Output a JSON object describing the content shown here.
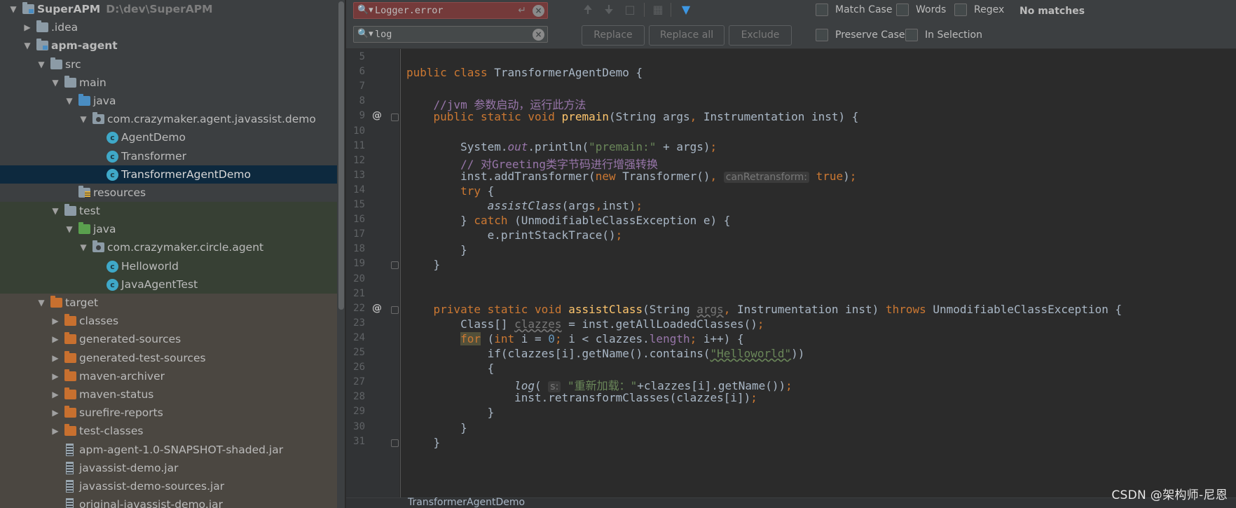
{
  "project_tree": {
    "rows": [
      {
        "label": "SuperAPM",
        "hint": "D:\\dev\\SuperAPM",
        "icon": "module-folder-icon",
        "expanded": true,
        "bold": true
      },
      {
        "label": ".idea",
        "icon": "folder-icon",
        "expanded": false
      },
      {
        "label": "apm-agent",
        "icon": "module-folder-icon",
        "expanded": true,
        "bold": true
      },
      {
        "label": "src",
        "icon": "folder-icon",
        "expanded": true
      },
      {
        "label": "main",
        "icon": "folder-icon",
        "expanded": true
      },
      {
        "label": "java",
        "icon": "source-root-icon",
        "expanded": true
      },
      {
        "label": "com.crazymaker.agent.javassist.demo",
        "icon": "package-icon",
        "expanded": true
      },
      {
        "label": "AgentDemo",
        "icon": "class-icon"
      },
      {
        "label": "Transformer",
        "icon": "class-icon"
      },
      {
        "label": "TransformerAgentDemo",
        "icon": "class-icon",
        "selected": true
      },
      {
        "label": "resources",
        "icon": "resources-folder-icon"
      },
      {
        "label": "test",
        "icon": "folder-icon",
        "expanded": true
      },
      {
        "label": "java",
        "icon": "test-source-root-icon",
        "expanded": true
      },
      {
        "label": "com.crazymaker.circle.agent",
        "icon": "package-icon",
        "expanded": true
      },
      {
        "label": "Helloworld",
        "icon": "class-icon"
      },
      {
        "label": "JavaAgentTest",
        "icon": "test-class-icon"
      },
      {
        "label": "target",
        "icon": "excluded-folder-icon",
        "expanded": true
      },
      {
        "label": "classes",
        "icon": "excluded-folder-icon",
        "expanded": false
      },
      {
        "label": "generated-sources",
        "icon": "excluded-folder-icon",
        "expanded": false
      },
      {
        "label": "generated-test-sources",
        "icon": "excluded-folder-icon",
        "expanded": false
      },
      {
        "label": "maven-archiver",
        "icon": "excluded-folder-icon",
        "expanded": false
      },
      {
        "label": "maven-status",
        "icon": "excluded-folder-icon",
        "expanded": false
      },
      {
        "label": "surefire-reports",
        "icon": "excluded-folder-icon",
        "expanded": false
      },
      {
        "label": "test-classes",
        "icon": "excluded-folder-icon",
        "expanded": false
      },
      {
        "label": "apm-agent-1.0-SNAPSHOT-shaded.jar",
        "icon": "jar-icon"
      },
      {
        "label": "javassist-demo.jar",
        "icon": "jar-icon"
      },
      {
        "label": "javassist-demo-sources.jar",
        "icon": "jar-icon"
      },
      {
        "label": "original-javassist-demo.jar",
        "icon": "jar-icon"
      }
    ]
  },
  "find_bar": {
    "search_value": "Logger.error",
    "replace_value": "log",
    "buttons": {
      "replace": "Replace",
      "replace_all": "Replace all",
      "exclude": "Exclude"
    },
    "options": {
      "match_case": "Match Case",
      "words": "Words",
      "regex": "Regex",
      "preserve_case": "Preserve Case",
      "in_selection": "In Selection"
    },
    "status": "No matches"
  },
  "editor": {
    "lines": [
      {
        "n": "5",
        "tokens": []
      },
      {
        "n": "6",
        "tokens": [
          {
            "t": "public class ",
            "c": "kw"
          },
          {
            "t": "TransformerAgentDemo {"
          }
        ]
      },
      {
        "n": "7",
        "tokens": []
      },
      {
        "n": "8",
        "tokens": [
          {
            "t": "    //jvm 参数启动，运行此方法",
            "c": "cm"
          }
        ]
      },
      {
        "n": "9",
        "mark": "@",
        "fold": true,
        "tokens": [
          {
            "t": "    public static void ",
            "c": "kw"
          },
          {
            "t": "premain",
            "c": "fn"
          },
          {
            "t": "(String args"
          },
          {
            "t": ", ",
            "c": "pn"
          },
          {
            "t": "Instrumentation inst) {"
          }
        ]
      },
      {
        "n": "10",
        "tokens": []
      },
      {
        "n": "11",
        "tokens": [
          {
            "t": "        System."
          },
          {
            "t": "out",
            "c": "field-it"
          },
          {
            "t": ".println("
          },
          {
            "t": "\"premain:\"",
            "c": "str"
          },
          {
            "t": " + args)"
          },
          {
            "t": ";",
            "c": "pn"
          }
        ]
      },
      {
        "n": "12",
        "tokens": [
          {
            "t": "        // 对Greeting类字节码进行增强转换",
            "c": "cm"
          }
        ]
      },
      {
        "n": "13",
        "tokens": [
          {
            "t": "        inst.addTransformer("
          },
          {
            "t": "new ",
            "c": "kw"
          },
          {
            "t": "Transformer()"
          },
          {
            "t": ", ",
            "c": "pn"
          },
          {
            "t": "canRetransform:",
            "c": "hint"
          },
          {
            "t": " "
          },
          {
            "t": "true",
            "c": "kw"
          },
          {
            "t": ")"
          },
          {
            "t": ";",
            "c": "pn"
          }
        ]
      },
      {
        "n": "14",
        "tokens": [
          {
            "t": "        "
          },
          {
            "t": "try ",
            "c": "kw"
          },
          {
            "t": "{"
          }
        ]
      },
      {
        "n": "15",
        "tokens": [
          {
            "t": "            "
          },
          {
            "t": "assistClass",
            "c": "it"
          },
          {
            "t": "(args"
          },
          {
            "t": ",",
            "c": "pn"
          },
          {
            "t": "inst)"
          },
          {
            "t": ";",
            "c": "pn"
          }
        ]
      },
      {
        "n": "16",
        "tokens": [
          {
            "t": "        } "
          },
          {
            "t": "catch ",
            "c": "kw"
          },
          {
            "t": "(UnmodifiableClassException e) {"
          }
        ]
      },
      {
        "n": "17",
        "tokens": [
          {
            "t": "            e.printStackTrace()"
          },
          {
            "t": ";",
            "c": "pn"
          }
        ]
      },
      {
        "n": "18",
        "tokens": [
          {
            "t": "        }"
          }
        ]
      },
      {
        "n": "19",
        "fold": true,
        "tokens": [
          {
            "t": "    }"
          }
        ]
      },
      {
        "n": "20",
        "tokens": []
      },
      {
        "n": "21",
        "tokens": []
      },
      {
        "n": "22",
        "mark": "@",
        "fold": true,
        "tokens": [
          {
            "t": "    private static void ",
            "c": "kw"
          },
          {
            "t": "assistClass",
            "c": "fn"
          },
          {
            "t": "(String "
          },
          {
            "t": "args",
            "c": "weak"
          },
          {
            "t": ", ",
            "c": "pn"
          },
          {
            "t": "Instrumentation inst) "
          },
          {
            "t": "throws ",
            "c": "kw"
          },
          {
            "t": "UnmodifiableClassException {"
          }
        ]
      },
      {
        "n": "23",
        "tokens": [
          {
            "t": "        Class[] "
          },
          {
            "t": "clazzes",
            "c": "wavy-plain"
          },
          {
            "t": " = inst.getAllLoadedClasses()"
          },
          {
            "t": ";",
            "c": "pn"
          }
        ]
      },
      {
        "n": "24",
        "tokens": [
          {
            "t": "        "
          },
          {
            "t": "for",
            "c": "kw-hl"
          },
          {
            "t": " ("
          },
          {
            "t": "int ",
            "c": "kw"
          },
          {
            "t": "i = "
          },
          {
            "t": "0",
            "c": "num"
          },
          {
            "t": "; ",
            "c": "pn"
          },
          {
            "t": "i < clazzes."
          },
          {
            "t": "length",
            "c": "field"
          },
          {
            "t": "; ",
            "c": "pn"
          },
          {
            "t": "i++) {"
          }
        ]
      },
      {
        "n": "25",
        "tokens": [
          {
            "t": "            if(clazzes[i].getName().contains("
          },
          {
            "t": "\"Helloworld\"",
            "c": "str-wavy"
          },
          {
            "t": "))"
          }
        ]
      },
      {
        "n": "26",
        "tokens": [
          {
            "t": "            {"
          }
        ]
      },
      {
        "n": "27",
        "tokens": [
          {
            "t": "                "
          },
          {
            "t": "log",
            "c": "it"
          },
          {
            "t": "( "
          },
          {
            "t": "s:",
            "c": "hint"
          },
          {
            "t": " "
          },
          {
            "t": "\"重新加载：\"",
            "c": "str"
          },
          {
            "t": "+clazzes[i].getName())"
          },
          {
            "t": ";",
            "c": "pn"
          }
        ]
      },
      {
        "n": "28",
        "tokens": [
          {
            "t": "                inst.retransformClasses(clazzes[i])"
          },
          {
            "t": ";",
            "c": "pn"
          }
        ]
      },
      {
        "n": "29",
        "tokens": [
          {
            "t": "            }"
          }
        ]
      },
      {
        "n": "30",
        "tokens": [
          {
            "t": "        }"
          }
        ]
      },
      {
        "n": "31",
        "fold": true,
        "tokens": [
          {
            "t": "    }"
          }
        ]
      }
    ]
  },
  "breadcrumb": "TransformerAgentDemo",
  "watermark": "CSDN @架构师-尼恩"
}
